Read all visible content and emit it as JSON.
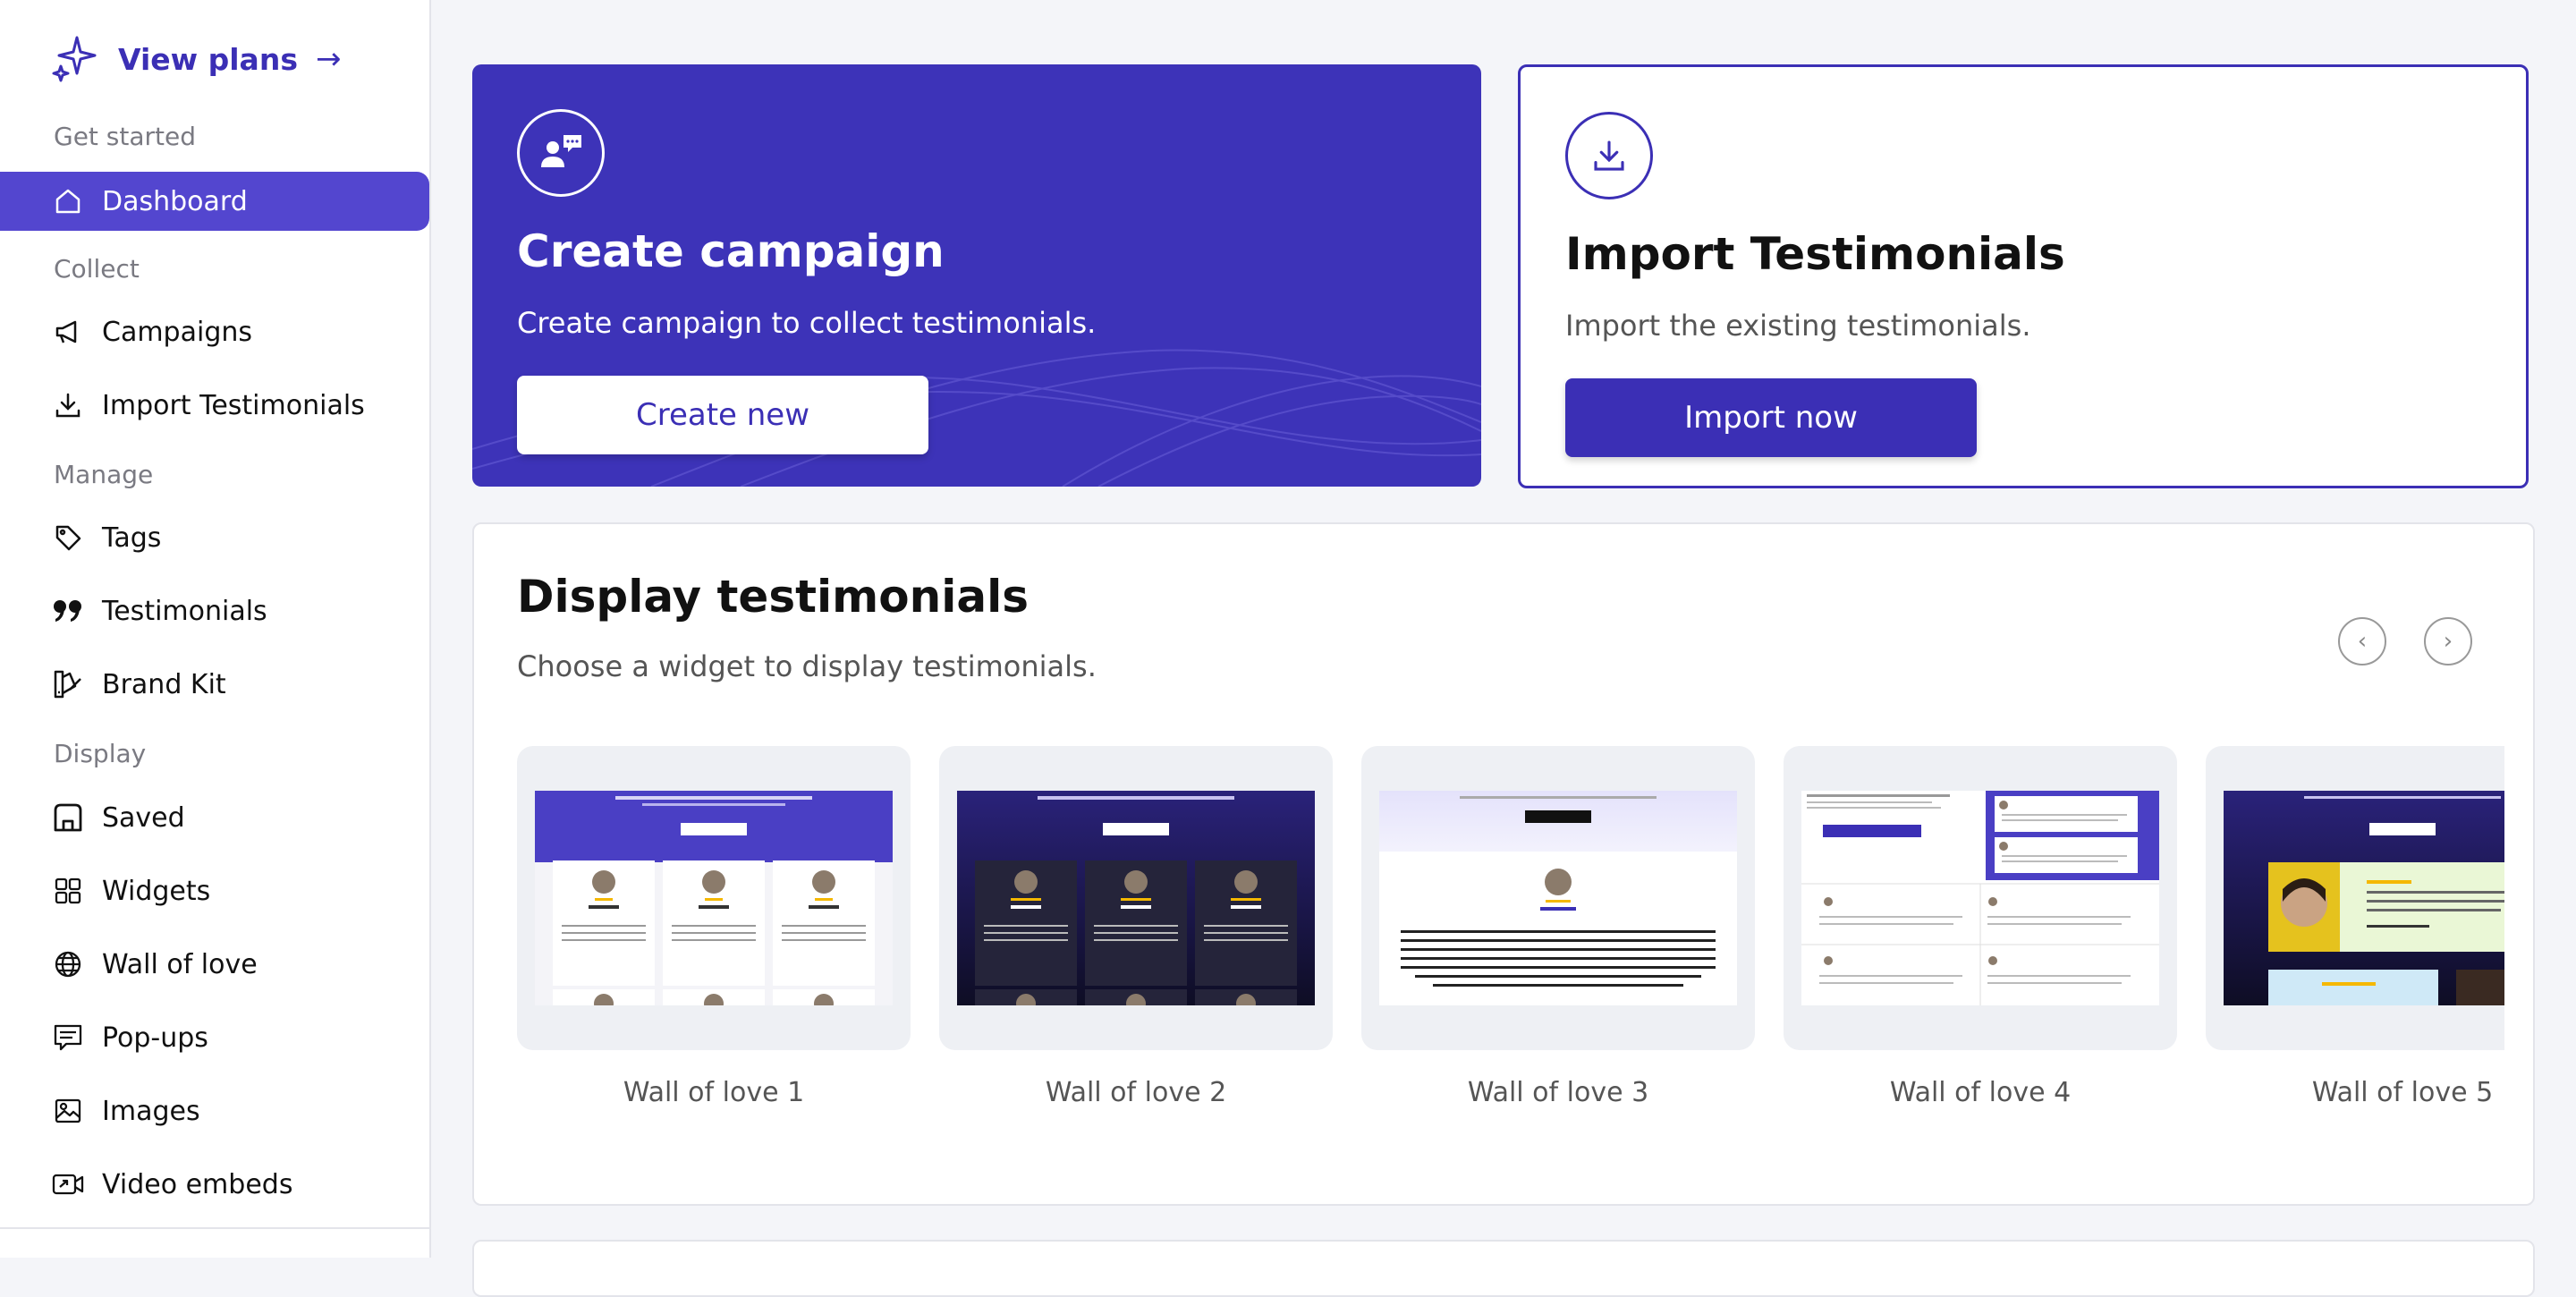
{
  "sidebar": {
    "view_plans": "View plans",
    "sections": {
      "get_started": "Get started",
      "collect": "Collect",
      "manage": "Manage",
      "display": "Display"
    },
    "items": [
      {
        "label": "Dashboard",
        "icon": "home-icon",
        "active": true
      },
      {
        "label": "Campaigns",
        "icon": "megaphone-icon"
      },
      {
        "label": "Import Testimonials",
        "icon": "download-icon"
      },
      {
        "label": "Tags",
        "icon": "tag-icon"
      },
      {
        "label": "Testimonials",
        "icon": "quote-icon"
      },
      {
        "label": "Brand Kit",
        "icon": "brand-kit-icon"
      },
      {
        "label": "Saved",
        "icon": "saved-icon"
      },
      {
        "label": "Widgets",
        "icon": "widgets-grid-icon"
      },
      {
        "label": "Wall of love",
        "icon": "globe-icon"
      },
      {
        "label": "Pop-ups",
        "icon": "popup-icon"
      },
      {
        "label": "Images",
        "icon": "image-icon"
      },
      {
        "label": "Video embeds",
        "icon": "video-icon"
      }
    ]
  },
  "campaign_card": {
    "title": "Create campaign",
    "subtitle": "Create campaign to collect testimonials.",
    "button": "Create new",
    "background": "#3d33b8"
  },
  "import_card": {
    "title": "Import Testimonials",
    "subtitle": "Import the existing testimonials.",
    "button": "Import now"
  },
  "display": {
    "title": "Display testimonials",
    "subtitle": "Choose a widget to display testimonials.",
    "widgets": [
      {
        "label": "Wall of love 1"
      },
      {
        "label": "Wall of love 2"
      },
      {
        "label": "Wall of love 3"
      },
      {
        "label": "Wall of love 4"
      },
      {
        "label": "Wall of love 5"
      }
    ]
  },
  "colors": {
    "accent": "#3b2fb5",
    "active_nav": "#5346cf",
    "page_bg": "#f4f5f9"
  }
}
